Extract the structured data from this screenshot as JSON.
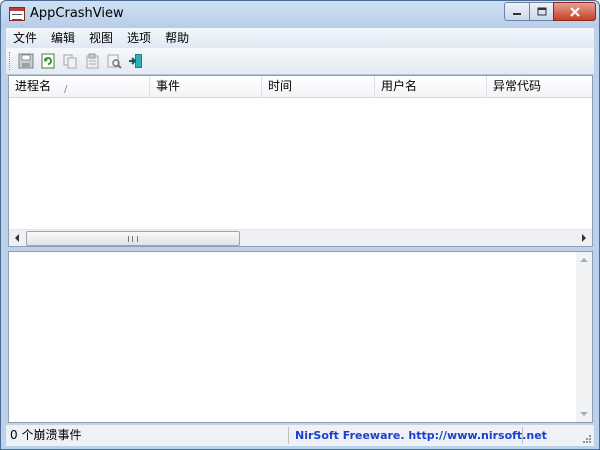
{
  "window": {
    "title": "AppCrashView",
    "icon": "app-crash-icon",
    "controls": [
      "minimize-icon",
      "maximize-icon",
      "close-icon"
    ]
  },
  "menu": {
    "items": [
      "文件",
      "编辑",
      "视图",
      "选项",
      "帮助"
    ]
  },
  "toolbar": {
    "buttons": [
      "save-icon",
      "refresh-icon",
      "copy-icon",
      "properties-icon",
      "find-icon",
      "exit-icon"
    ]
  },
  "list": {
    "columns": [
      "进程名",
      "事件",
      "时间",
      "用户名",
      "异常代码"
    ],
    "sort_indicator": "/",
    "rows": []
  },
  "status": {
    "count_text": "0 个崩溃事件",
    "link_text": "NirSoft Freeware.  http://www.nirsoft.net"
  },
  "colors": {
    "link": "#1a3fd0",
    "frame": "#bcd1ea"
  }
}
